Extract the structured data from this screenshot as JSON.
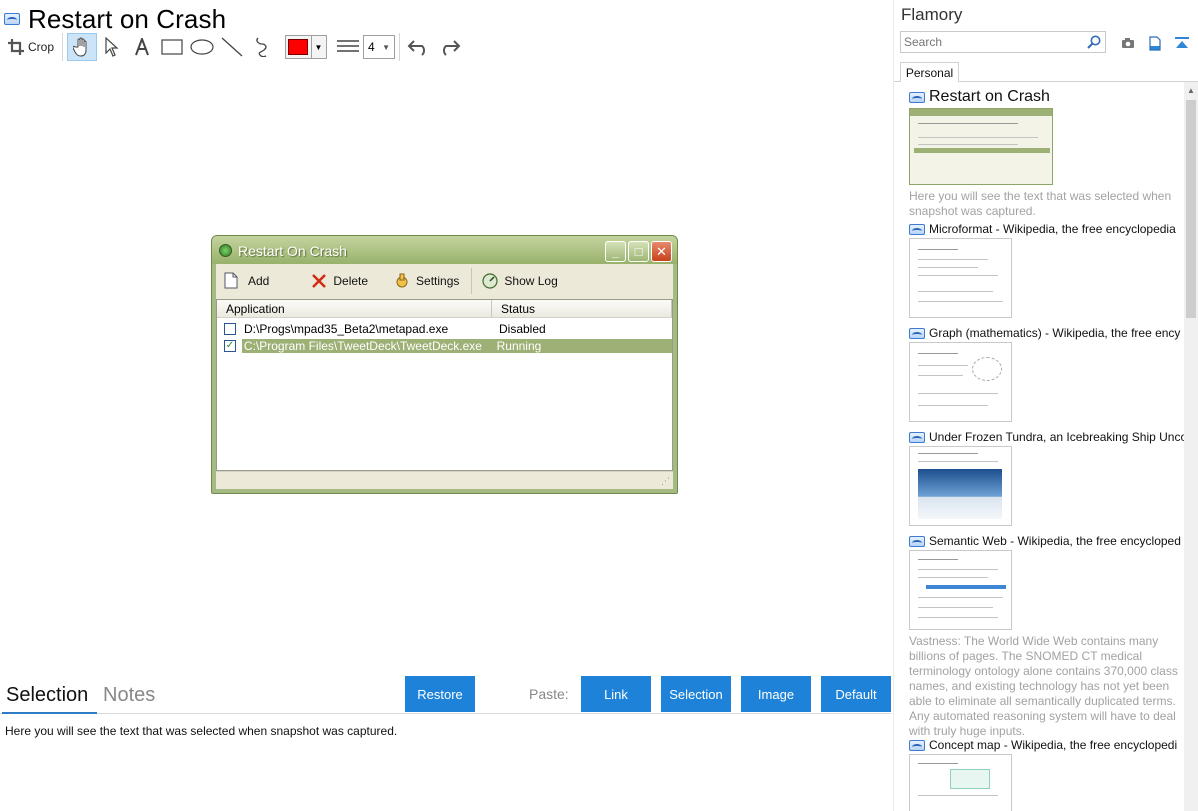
{
  "left": {
    "title": "Restart on Crash",
    "toolbar": {
      "crop_label": "Crop",
      "color": "#ff0000",
      "line_width": "4",
      "tools": [
        "hand-tool",
        "pointer-tool",
        "text-tool",
        "rectangle-tool",
        "ellipse-tool",
        "line-tool",
        "freehand-tool",
        "undo",
        "redo"
      ]
    },
    "snapshot": {
      "window_title": "Restart On Crash",
      "tools": {
        "add": "Add",
        "delete": "Delete",
        "settings": "Settings",
        "show_log": "Show Log"
      },
      "columns": {
        "application": "Application",
        "status": "Status"
      },
      "rows": [
        {
          "path": "D:\\Progs\\mpad35_Beta2\\metapad.exe",
          "status": "Disabled",
          "checked": false,
          "selected": false
        },
        {
          "path": "C:\\Program Files\\TweetDeck\\TweetDeck.exe",
          "status": "Running",
          "checked": true,
          "selected": true
        }
      ],
      "accent_color": "#a5b982"
    },
    "tabs": {
      "selection": "Selection",
      "notes": "Notes"
    },
    "buttons": {
      "restore": "Restore",
      "paste_label": "Paste:",
      "link": "Link",
      "selection": "Selection",
      "image": "Image",
      "default": "Default",
      "button_color": "#1e82d8"
    },
    "selection_text": "Here you will see the text that was selected when snapshot was captured."
  },
  "right": {
    "title": "Flamory",
    "search_placeholder": "Search",
    "tab": "Personal",
    "entries": [
      {
        "title": "Restart on Crash",
        "desc": "Here you will see the text that was selected when snapshot was captured."
      },
      {
        "title": "Microformat - Wikipedia, the free encyclopedia",
        "desc": ""
      },
      {
        "title": "Graph (mathematics) - Wikipedia, the free ency",
        "desc": ""
      },
      {
        "title": "Under Frozen Tundra, an Icebreaking Ship Unco",
        "desc": ""
      },
      {
        "title": "Semantic Web - Wikipedia, the free encycloped",
        "desc": "Vastness: The World Wide Web contains many billions of pages. The SNOMED CT medical terminology ontology alone contains 370,000 class names, and existing technology has not yet been able to eliminate all semantically duplicated terms. Any automated reasoning system will have to deal with truly huge inputs."
      },
      {
        "title": "Concept map - Wikipedia, the free encyclopedi",
        "desc": ""
      }
    ]
  }
}
